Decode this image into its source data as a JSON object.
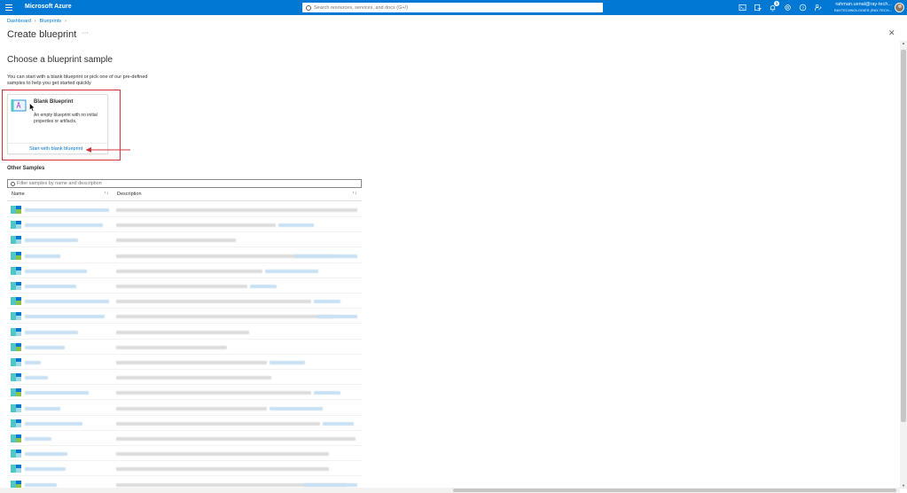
{
  "topbar": {
    "brand": "Microsoft Azure",
    "search_placeholder": "Search resources, services, and docs (G+/)",
    "notification_count": "1",
    "account_name": "rahman.uenal@ray-tech...",
    "account_org": "RAYTECHNOLOGIES (RAY-TECH...",
    "icons": [
      "cloud-shell-icon",
      "directory-filter-icon",
      "bell-icon",
      "gear-icon",
      "help-icon",
      "feedback-icon"
    ]
  },
  "breadcrumb": {
    "items": [
      "Dashboard",
      "Blueprints"
    ]
  },
  "page": {
    "title": "Create blueprint",
    "more": "···",
    "close": "✕"
  },
  "section": {
    "title": "Choose a blueprint sample",
    "intro": "You can start with a blank blueprint or pick one of our pre-defined samples to help you get started quickly"
  },
  "card": {
    "title": "Blank Blueprint",
    "description": "An empty blueprint with no initial properties or artifacts.",
    "link": "Start with blank blueprint"
  },
  "other_samples": {
    "title": "Other Samples",
    "filter_placeholder": "Filter samples by name and description",
    "columns": [
      "Name",
      "Description"
    ],
    "sort_glyph": "↑↓",
    "row_count": 19
  },
  "colors": {
    "accent": "#0078d4",
    "highlight": "#d13438",
    "icon_teal": "#50c7c7",
    "icon_blue": "#0078d4",
    "icon_green": "#8bc34a"
  }
}
